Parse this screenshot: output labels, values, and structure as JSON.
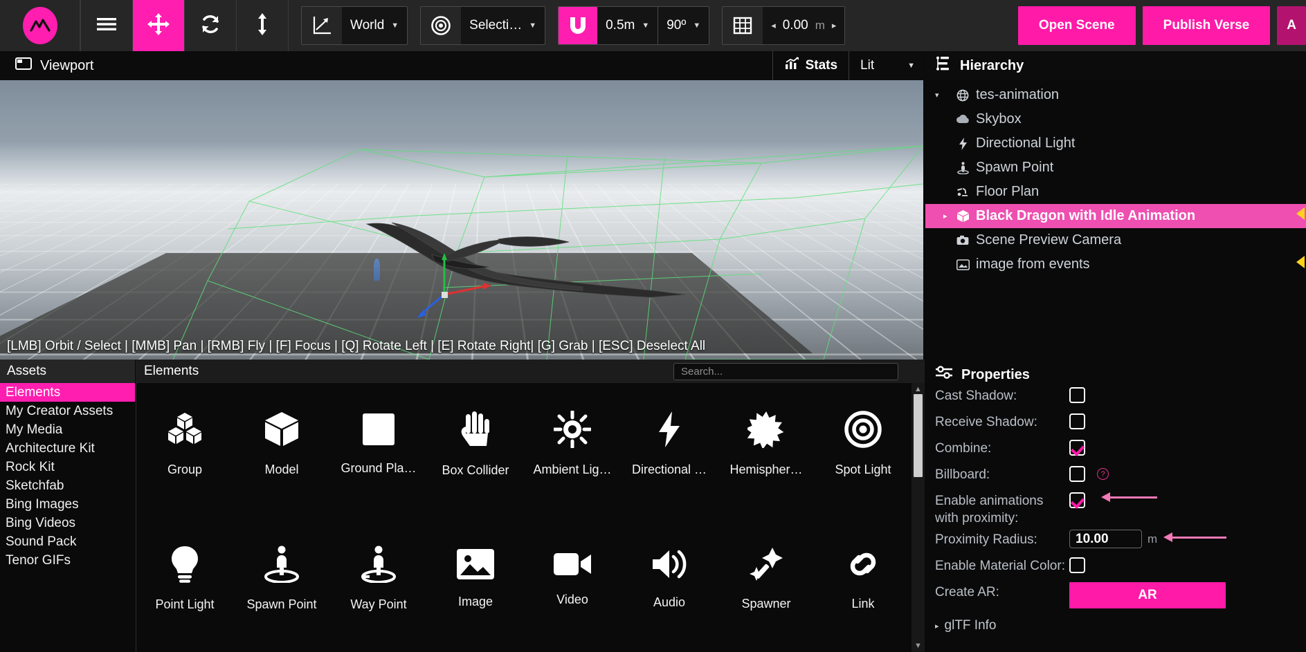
{
  "toolbar": {
    "logo_icon": "brand-mountain-logo",
    "menu_icon": "hamburger-menu-icon",
    "move_icon": "move-tool-icon",
    "rotate_icon": "rotate-tool-icon",
    "scale_icon": "scale-tool-icon",
    "axis_icon": "axis-gizmo-icon",
    "coord_space": "World",
    "pivot_icon": "pivot-target-icon",
    "pivot_mode": "Selecti…",
    "snap_icon": "magnet-snap-icon",
    "snap_distance": "0.5m",
    "snap_angle": "90º",
    "grid_icon": "grid-icon",
    "grid_height": "0.00",
    "grid_unit": "m",
    "grid_prev": "◂",
    "grid_next": "▸",
    "open_scene_label": "Open Scene",
    "publish_verse_label": "Publish Verse",
    "partial_button_label": "A"
  },
  "viewport": {
    "panel_icon": "viewport-panel-icon",
    "title": "Viewport",
    "stats_icon": "stats-chart-icon",
    "stats_label": "Stats",
    "shading_mode": "Lit",
    "caret": "▾",
    "hint": "[LMB] Orbit / Select | [MMB] Pan | [RMB] Fly | [F] Focus | [Q] Rotate Left | [E] Rotate Right| [G] Grab | [ESC] Deselect All"
  },
  "assets": {
    "header": "Assets",
    "items": [
      {
        "label": "Elements",
        "active": true
      },
      {
        "label": "My Creator Assets",
        "active": false
      },
      {
        "label": "My Media",
        "active": false
      },
      {
        "label": "Architecture Kit",
        "active": false
      },
      {
        "label": "Rock Kit",
        "active": false
      },
      {
        "label": "Sketchfab",
        "active": false
      },
      {
        "label": "Bing Images",
        "active": false
      },
      {
        "label": "Bing Videos",
        "active": false
      },
      {
        "label": "Sound Pack",
        "active": false
      },
      {
        "label": "Tenor GIFs",
        "active": false
      }
    ]
  },
  "elements": {
    "header": "Elements",
    "search_placeholder": "Search...",
    "search_value": "",
    "items": [
      {
        "label": "Group",
        "icon": "group-cubes-icon"
      },
      {
        "label": "Model",
        "icon": "model-cube-icon"
      },
      {
        "label": "Ground Pla…",
        "icon": "ground-plane-icon"
      },
      {
        "label": "Box Collider",
        "icon": "box-collider-hand-icon"
      },
      {
        "label": "Ambient Lig…",
        "icon": "ambient-light-sun-icon"
      },
      {
        "label": "Directional …",
        "icon": "directional-light-bolt-icon"
      },
      {
        "label": "Hemispher…",
        "icon": "hemisphere-light-icon"
      },
      {
        "label": "Spot Light",
        "icon": "spot-light-target-icon"
      },
      {
        "label": "Point Light",
        "icon": "point-light-bulb-icon"
      },
      {
        "label": "Spawn Point",
        "icon": "spawn-point-icon"
      },
      {
        "label": "Way Point",
        "icon": "way-point-icon"
      },
      {
        "label": "Image",
        "icon": "image-picture-icon"
      },
      {
        "label": "Video",
        "icon": "video-camera-icon"
      },
      {
        "label": "Audio",
        "icon": "audio-speaker-icon"
      },
      {
        "label": "Spawner",
        "icon": "spawner-wand-icon"
      },
      {
        "label": "Link",
        "icon": "link-chain-icon"
      }
    ]
  },
  "hierarchy": {
    "panel_icon": "hierarchy-tree-icon",
    "header": "Hierarchy",
    "items": [
      {
        "label": "tes-animation",
        "icon": "globe-icon",
        "twisty": "▾",
        "indent": 0,
        "selected": false
      },
      {
        "label": "Skybox",
        "icon": "cloud-icon",
        "twisty": "",
        "indent": 1,
        "selected": false
      },
      {
        "label": "Directional Light",
        "icon": "bolt-icon",
        "twisty": "",
        "indent": 1,
        "selected": false
      },
      {
        "label": "Spawn Point",
        "icon": "spawn-point-icon",
        "twisty": "",
        "indent": 1,
        "selected": false
      },
      {
        "label": "Floor Plan",
        "icon": "floor-plan-icon",
        "twisty": "",
        "indent": 1,
        "selected": false
      },
      {
        "label": "Black Dragon with Idle Animation",
        "icon": "model-cube-icon",
        "twisty": "▸",
        "indent": 1,
        "selected": true
      },
      {
        "label": "Scene Preview Camera",
        "icon": "camera-icon",
        "twisty": "",
        "indent": 1,
        "selected": false
      },
      {
        "label": "image from events",
        "icon": "image-picture-icon",
        "twisty": "",
        "indent": 1,
        "selected": false
      }
    ]
  },
  "properties": {
    "panel_icon": "properties-sliders-icon",
    "header": "Properties",
    "rows": [
      {
        "label": "Cast Shadow:",
        "type": "checkbox",
        "checked": false
      },
      {
        "label": "Receive Shadow:",
        "type": "checkbox",
        "checked": false
      },
      {
        "label": "Combine:",
        "type": "checkbox",
        "checked": true
      },
      {
        "label": "Billboard:",
        "type": "checkbox",
        "checked": false,
        "help": "?"
      },
      {
        "label": "Enable animations with proximity:",
        "type": "checkbox",
        "checked": true,
        "annotated": true
      },
      {
        "label": "Proximity Radius:",
        "type": "number",
        "value": "10.00",
        "unit": "m",
        "annotated": true
      },
      {
        "label": "Enable Material Color:",
        "type": "checkbox",
        "checked": false
      },
      {
        "label": "Create AR:",
        "type": "button",
        "button_label": "AR"
      }
    ],
    "gltf_info_label": "glTF Info",
    "gltf_twisty": "▸"
  },
  "colors": {
    "accent_pink": "#ff1eb0",
    "accent_pink_bright": "#ff1aa8",
    "selection_pink": "#ee4fb0",
    "annotation_pink": "#f37ab8",
    "marker_yellow": "#ffd21e",
    "toolbar_bg": "#262626",
    "panel_bg": "#0a0a0a",
    "text_muted": "#b9bfc6"
  }
}
